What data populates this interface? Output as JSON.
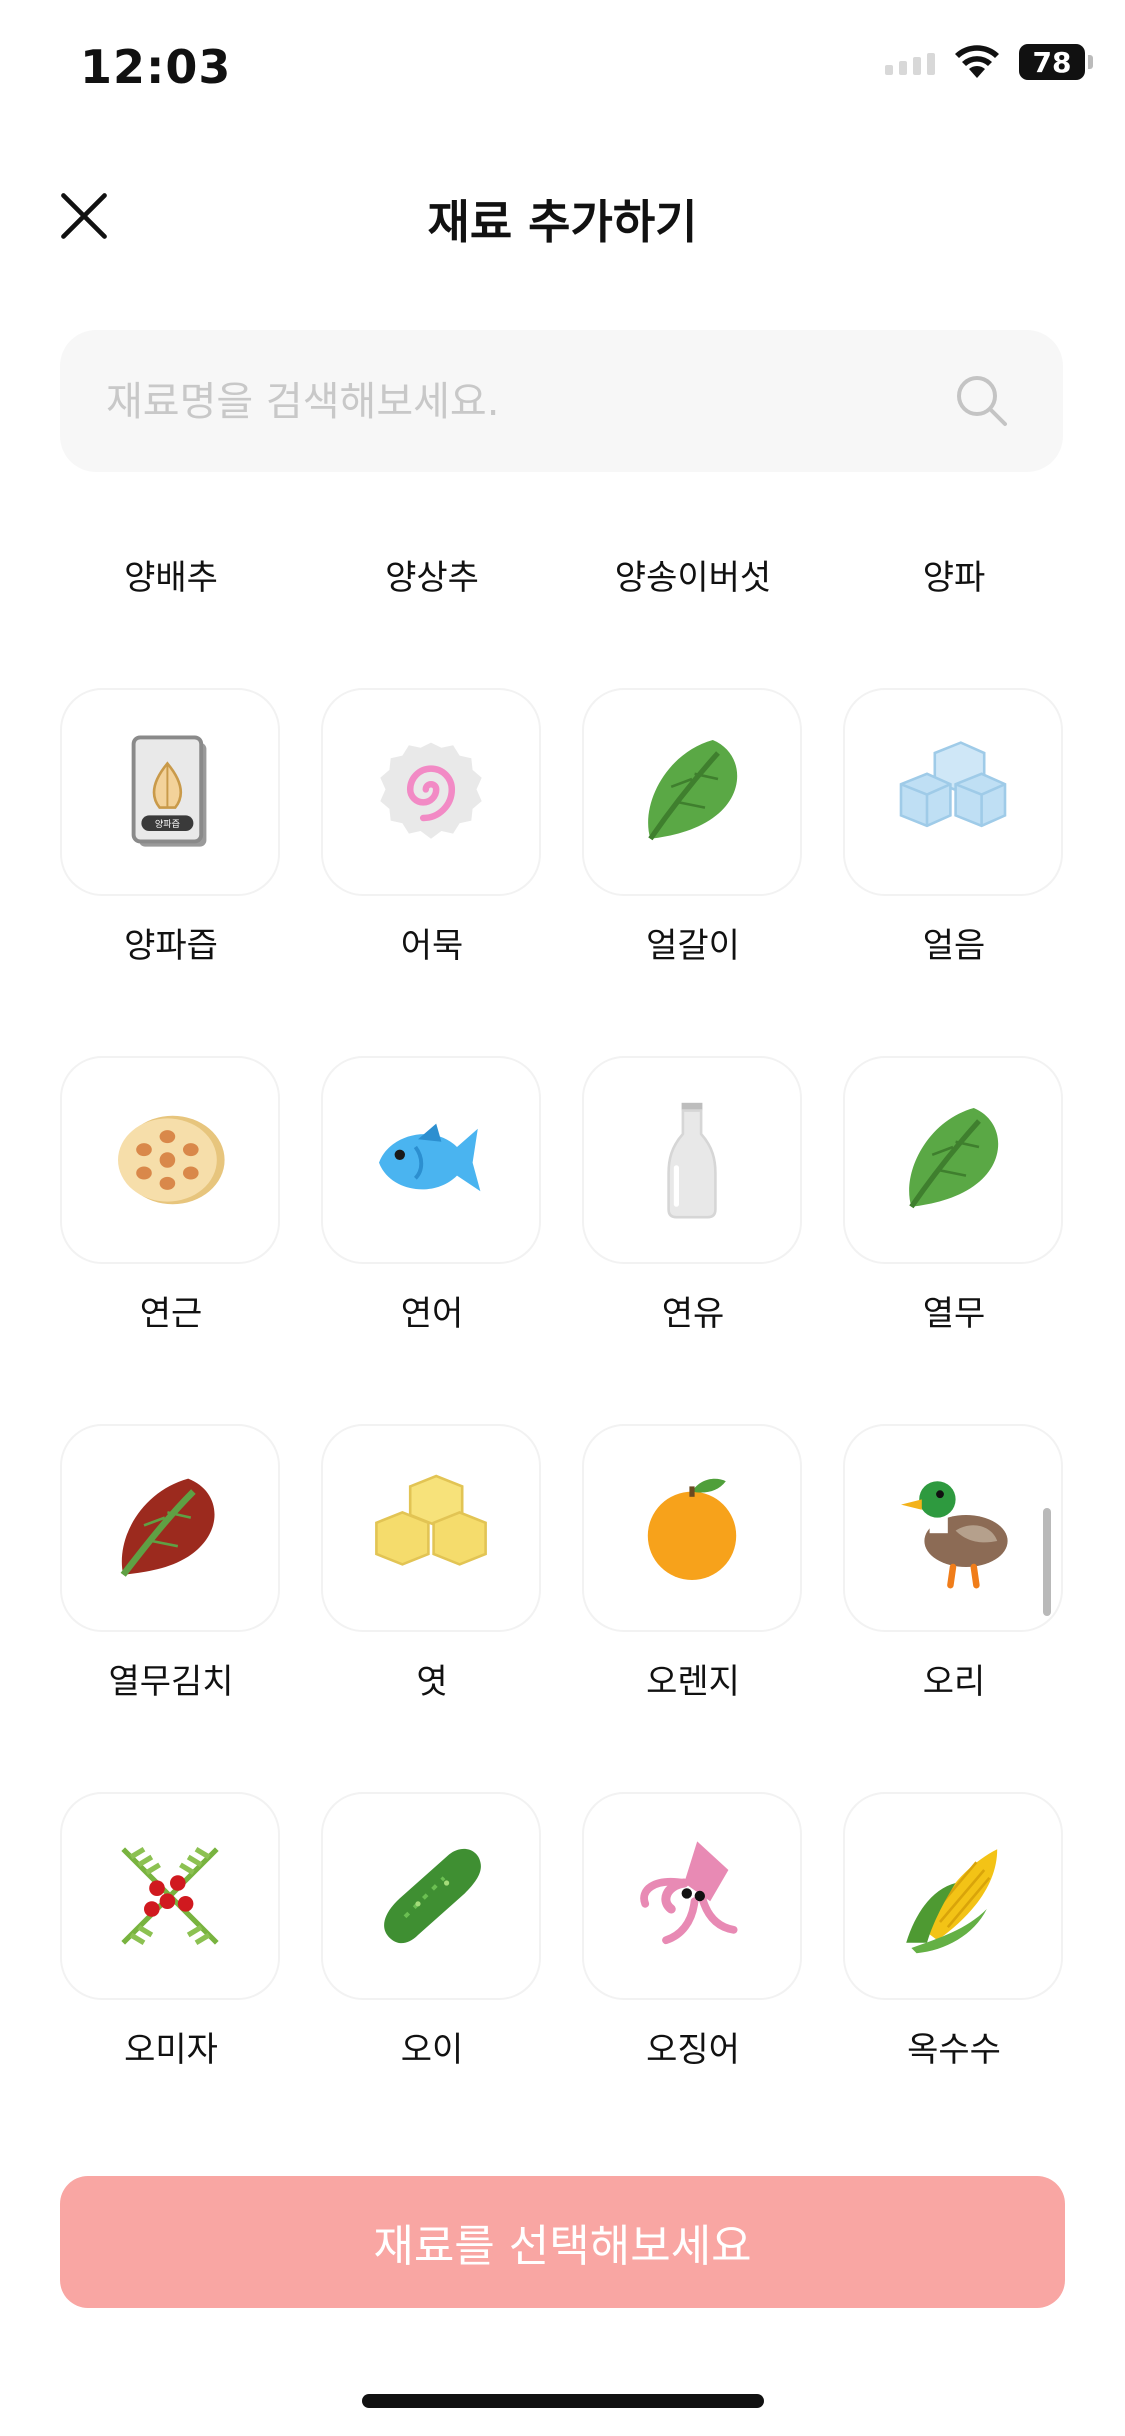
{
  "status": {
    "time": "12:03",
    "battery": "78"
  },
  "header": {
    "title": "재료 추가하기"
  },
  "search": {
    "placeholder": "재료명을 검색해보세요."
  },
  "partial_row": [
    "양배추",
    "양상추",
    "양송이버섯",
    "양파"
  ],
  "ingredients": [
    {
      "name": "양파즙",
      "icon": "onion-juice-pack-icon",
      "pack_label": "양파즙"
    },
    {
      "name": "어묵",
      "icon": "fishcake-icon"
    },
    {
      "name": "얼갈이",
      "icon": "green-leaf-icon"
    },
    {
      "name": "얼음",
      "icon": "ice-cubes-icon"
    },
    {
      "name": "연근",
      "icon": "lotus-root-icon"
    },
    {
      "name": "연어",
      "icon": "fish-icon"
    },
    {
      "name": "연유",
      "icon": "milk-bottle-icon"
    },
    {
      "name": "열무",
      "icon": "green-leaf-icon"
    },
    {
      "name": "열무김치",
      "icon": "red-leaf-icon"
    },
    {
      "name": "엿",
      "icon": "yellow-cubes-icon"
    },
    {
      "name": "오렌지",
      "icon": "orange-icon"
    },
    {
      "name": "오리",
      "icon": "duck-icon"
    },
    {
      "name": "오미자",
      "icon": "schisandra-berries-icon"
    },
    {
      "name": "오이",
      "icon": "cucumber-icon"
    },
    {
      "name": "오징어",
      "icon": "squid-icon"
    },
    {
      "name": "옥수수",
      "icon": "corn-icon"
    }
  ],
  "cta": {
    "label": "재료를 선택해보세요"
  },
  "colors": {
    "cta_bg": "#f9a6a3",
    "tile_border": "#f2f2f2",
    "search_bg": "#f7f7f7"
  }
}
